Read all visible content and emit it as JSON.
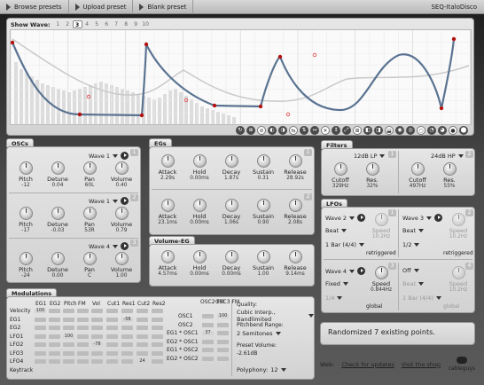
{
  "topbar": {
    "browse": "Browse presets",
    "upload": "Upload preset",
    "blank": "Blank preset",
    "preset_name": "SEQ-ItaloDisco"
  },
  "wave": {
    "label": "Show Wave:",
    "tabs": [
      "1",
      "2",
      "3",
      "4",
      "5",
      "6",
      "7",
      "8",
      "9",
      "10"
    ],
    "active_index": 2
  },
  "oscs": {
    "title": "OSCs",
    "units": [
      {
        "wave": "Wave 1",
        "pitch": "-12",
        "detune": "0.04",
        "pan": "60L",
        "volume": "0.40"
      },
      {
        "wave": "Wave 1",
        "pitch": "-17",
        "detune": "-0.03",
        "pan": "53R",
        "volume": "0.79"
      },
      {
        "wave": "Wave 4",
        "pitch": "-24",
        "detune": "0.00",
        "pan": "C",
        "volume": "1.00"
      }
    ],
    "labels": {
      "pitch": "Pitch",
      "detune": "Detune",
      "pan": "Pan",
      "volume": "Volume"
    }
  },
  "egs": {
    "title": "EGs",
    "units": [
      {
        "attack": "2.29s",
        "hold": "0.00ms",
        "decay": "1.87s",
        "sustain": "0.31",
        "release": "28.92s"
      },
      {
        "attack": "23.1ms",
        "hold": "0.00ms",
        "decay": "1.06s",
        "sustain": "0.90",
        "release": "2.08s"
      }
    ],
    "labels": {
      "attack": "Attack",
      "hold": "Hold",
      "decay": "Decay",
      "sustain": "Sustain",
      "release": "Release"
    }
  },
  "volume_eg": {
    "title": "Volume-EG",
    "attack": "4.57ms",
    "hold": "0.00ms",
    "decay": "0.00ms",
    "sustain": "1.00",
    "release": "9.14ms"
  },
  "filters": {
    "title": "Filters",
    "units": [
      {
        "type": "12dB LP",
        "cutoff": "329Hz",
        "res": "32%"
      },
      {
        "type": "24dB HP",
        "cutoff": "497Hz",
        "res": "55%"
      }
    ],
    "labels": {
      "cutoff": "Cutoff",
      "res": "Res."
    }
  },
  "lfos": {
    "title": "LFOs",
    "units": [
      {
        "wave": "Wave 2",
        "mode": "Beat",
        "rate": "1 Bar (4/4)",
        "speed_label": "Speed",
        "speed": "10.2Hz",
        "flag": "retriggered",
        "dim": false
      },
      {
        "wave": "Wave 3",
        "mode": "Beat",
        "rate": "1/2",
        "speed_label": "Speed",
        "speed": "10.2Hz",
        "flag": "retriggered",
        "dim": false
      },
      {
        "wave": "Wave 4",
        "mode": "Fixed",
        "rate": "1/4",
        "speed_label": "Speed",
        "speed": "0.844Hz",
        "flag": "global",
        "dim": false
      },
      {
        "wave": "Off",
        "mode": "Beat",
        "rate": "1 Bar (4/4)",
        "speed_label": "Speed",
        "speed": "10.2Hz",
        "flag": "global",
        "dim": true
      }
    ]
  },
  "modulations": {
    "title": "Modulations",
    "cols": [
      "EG1",
      "EG2",
      "Pitch",
      "FM",
      "Vol",
      "Cut1",
      "Res1",
      "Cut2",
      "Res2"
    ],
    "rows": [
      "Velocity",
      "EG1",
      "EG2",
      "LFO1",
      "LFO2",
      "LFO3",
      "LFO4",
      "Keytrack"
    ],
    "values": [
      {
        "row": 0,
        "col": 0,
        "text": "100"
      },
      {
        "row": 1,
        "col": 6,
        "text": "-58"
      },
      {
        "row": 3,
        "col": 2,
        "text": "100"
      },
      {
        "row": 4,
        "col": 4,
        "text": "-78"
      },
      {
        "row": 6,
        "col": 7,
        "text": "24"
      }
    ],
    "osc_fm_header": [
      "OSC2 FM",
      "OSC3 FM"
    ],
    "osc_rows": [
      "OSC1",
      "OSC2",
      "EG1 * OSC1",
      "EG2 * OSC1",
      "EG1 * OSC2",
      "EG2 * OSC2"
    ],
    "osc_values": [
      {
        "row": 0,
        "col": 1,
        "text": "100"
      },
      {
        "row": 2,
        "col": 0,
        "text": "37"
      }
    ],
    "quality_label": "Quality:",
    "quality": "Cubic Interp., Bandlimited",
    "pitchbend_label": "Pitchbend Range:",
    "pitchbend": "2 Semitones",
    "preset_volume_label": "Preset Volume:",
    "preset_volume": "-2.61dB",
    "polyphony_label": "Polyphony:",
    "polyphony": "12"
  },
  "status": "Randomized 7 existing points.",
  "footer": {
    "web_label": "Web:",
    "updates": "Check for updates",
    "shop": "Visit the shop",
    "brand": "cableguys"
  },
  "colors": {
    "curve": "#5a7391",
    "point": "#b31010",
    "ghost_point": "#e04040"
  }
}
